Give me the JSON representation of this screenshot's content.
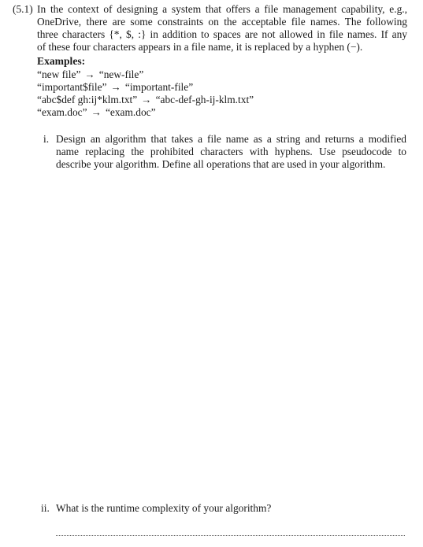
{
  "question": {
    "number": "(5.1)",
    "intro_lines": [
      "In the context of designing a system that offers a file management capability, e.g.,",
      "OneDrive, there are some constraints on the acceptable file names. The following",
      "three characters {*, $, :} in addition to spaces are not allowed in file names. If any",
      "of these four characters appears in a file name, it is replaced by a hyphen (−)."
    ],
    "examples_title": "Examples:",
    "arrow": "→",
    "examples": [
      {
        "input": "“new file”",
        "output": "“new-file”"
      },
      {
        "input": "“important$file”",
        "output": "“important-file”"
      },
      {
        "input": "“abc$def gh:ij*klm.txt”",
        "output": "“abc-def-gh-ij-klm.txt”"
      },
      {
        "input": "“exam.doc”",
        "output": "“exam.doc”"
      }
    ],
    "parts": [
      {
        "number": "i.",
        "lines": [
          "Design an algorithm that takes a file name as a string and returns a modified",
          "name replacing the prohibited characters with hyphens.  Use pseudocode to",
          "describe your algorithm. Define all operations that are used in your algorithm."
        ]
      },
      {
        "number": "ii.",
        "lines": [
          "What is the runtime complexity of your algorithm?"
        ]
      }
    ]
  }
}
